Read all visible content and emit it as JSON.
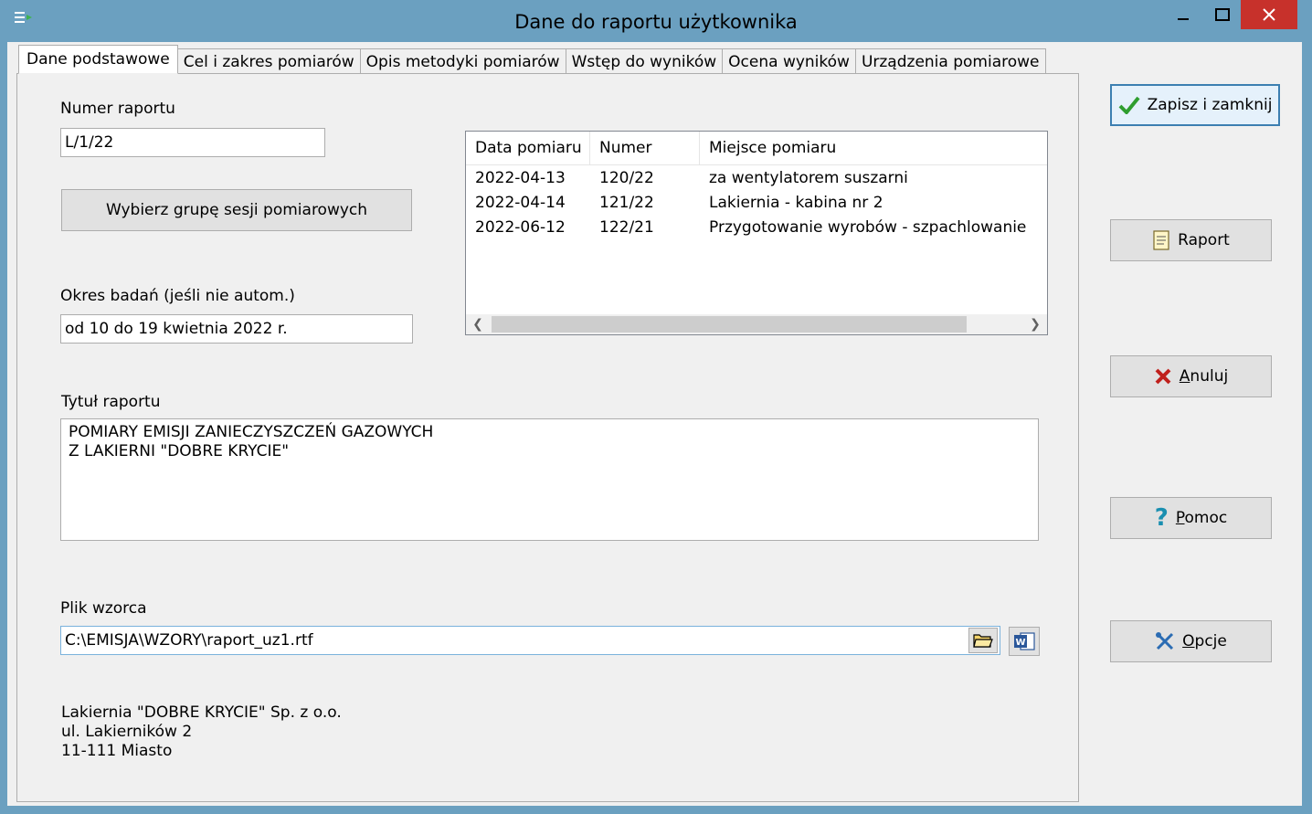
{
  "window": {
    "title": "Dane do raportu użytkownika",
    "controls": {
      "minimize": "—",
      "maximize": "☐",
      "close": "✕"
    }
  },
  "tabs": [
    {
      "label": "Dane podstawowe",
      "active": true
    },
    {
      "label": "Cel i zakres pomiarów",
      "active": false
    },
    {
      "label": "Opis metodyki pomiarów",
      "active": false
    },
    {
      "label": "Wstęp do wyników",
      "active": false
    },
    {
      "label": "Ocena wyników",
      "active": false
    },
    {
      "label": "Urządzenia pomiarowe",
      "active": false
    }
  ],
  "form": {
    "report_number_label": "Numer raportu",
    "report_number_value": "L/1/22",
    "choose_group_button": "Wybierz grupę sesji pomiarowych",
    "period_label": "Okres badań  (jeśli nie autom.)",
    "period_value": "od 10 do 19 kwietnia 2022 r.",
    "title_label": "Tytuł raportu",
    "title_value": "POMIARY EMISJI ZANIECZYSZCZEŃ GAZOWYCH\nZ LAKIERNI \"DOBRE KRYCIE\"",
    "template_label": "Plik wzorca",
    "template_value": "C:\\EMISJA\\WZORY\\raport_uz1.rtf",
    "company_line1": "Lakiernia \"DOBRE KRYCIE\"  Sp. z o.o.",
    "company_line2": "ul. Lakierników 2",
    "company_line3": "11-111  Miasto"
  },
  "sessions": {
    "columns": [
      "Data pomiaru",
      "Numer",
      "Miejsce pomiaru"
    ],
    "rows": [
      [
        "2022-04-13",
        "120/22",
        "za wentylatorem suszarni"
      ],
      [
        "2022-04-14",
        "121/22",
        "Lakiernia - kabina nr 2"
      ],
      [
        "2022-06-12",
        "122/21",
        "Przygotowanie wyrobów - szpachlowanie"
      ]
    ]
  },
  "side_buttons": {
    "save_close": "Zapisz i zamknij",
    "report": "Raport",
    "cancel": "Anuluj",
    "help": "Pomoc",
    "options": "Opcje"
  },
  "colors": {
    "titlebar": "#6ba0c0",
    "close_button": "#c7312b",
    "accent_green": "#2f9e2f",
    "accent_red": "#c0201c",
    "accent_blue": "#2b6cb3"
  }
}
